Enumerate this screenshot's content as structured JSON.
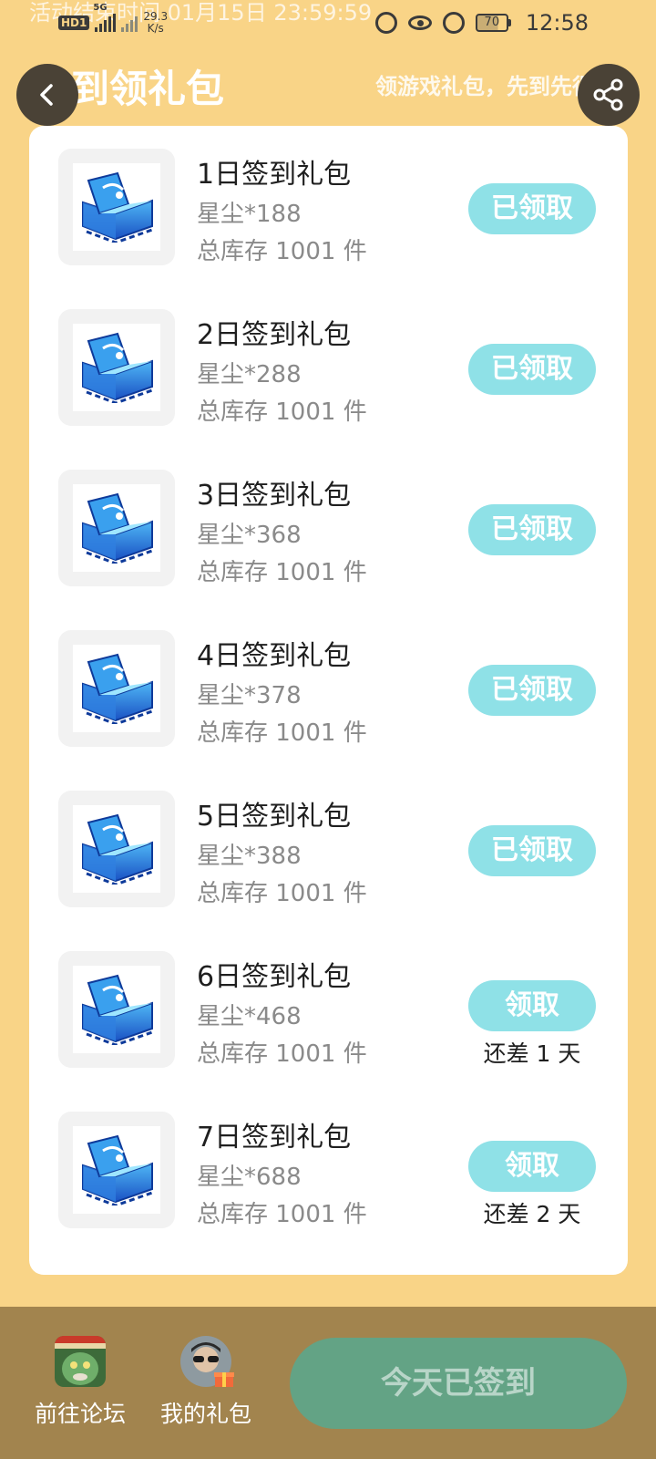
{
  "status_bar": {
    "overlay_text": "活动结束时间 01月15日 23:59:59",
    "hd_label": "HD",
    "sim_label": "1",
    "network_type": "5G",
    "net_speed_value": "29.3",
    "net_speed_unit": "K/s",
    "battery_level": "70",
    "time": "12:58"
  },
  "header": {
    "title": "签到领礼包",
    "tagline": "领游戏礼包，先到先得"
  },
  "gifts": [
    {
      "name": "1日签到礼包",
      "content": "星尘*188",
      "stock": "总库存 1001 件",
      "button": "已领取",
      "claimed": true,
      "days_left": ""
    },
    {
      "name": "2日签到礼包",
      "content": "星尘*288",
      "stock": "总库存 1001 件",
      "button": "已领取",
      "claimed": true,
      "days_left": ""
    },
    {
      "name": "3日签到礼包",
      "content": "星尘*368",
      "stock": "总库存 1001 件",
      "button": "已领取",
      "claimed": true,
      "days_left": ""
    },
    {
      "name": "4日签到礼包",
      "content": "星尘*378",
      "stock": "总库存 1001 件",
      "button": "已领取",
      "claimed": true,
      "days_left": ""
    },
    {
      "name": "5日签到礼包",
      "content": "星尘*388",
      "stock": "总库存 1001 件",
      "button": "已领取",
      "claimed": true,
      "days_left": ""
    },
    {
      "name": "6日签到礼包",
      "content": "星尘*468",
      "stock": "总库存 1001 件",
      "button": "领取",
      "claimed": false,
      "days_left": "还差 1 天"
    },
    {
      "name": "7日签到礼包",
      "content": "星尘*688",
      "stock": "总库存 1001 件",
      "button": "领取",
      "claimed": false,
      "days_left": "还差 2 天"
    }
  ],
  "bottom_bar": {
    "forum_label": "前往论坛",
    "my_gifts_label": "我的礼包",
    "signed_label": "今天已签到"
  },
  "colors": {
    "page_bg": "#F9D487",
    "claim_button": "#8FE1E7",
    "bottom_bar": "#A2844E",
    "signed_button": "#63A385"
  },
  "icons": {
    "back": "chevron-left-icon",
    "share": "share-icon",
    "gift": "treasure-chest-icon"
  }
}
